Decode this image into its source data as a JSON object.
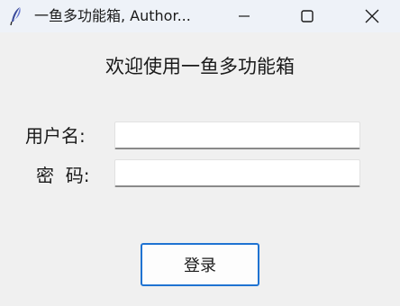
{
  "window": {
    "title": "一鱼多功能箱, Author...",
    "controls": [
      "minimize-icon",
      "maximize-icon",
      "close-icon"
    ]
  },
  "welcome_text": "欢迎使用一鱼多功能箱",
  "form": {
    "username_label": "用户名:",
    "username_value": "",
    "password_label": "密  码:",
    "password_value": "",
    "login_label": "登录"
  },
  "colors": {
    "titlebar": "#eef2f8",
    "background": "#f0f0f0",
    "button_border": "#1f73d2"
  }
}
